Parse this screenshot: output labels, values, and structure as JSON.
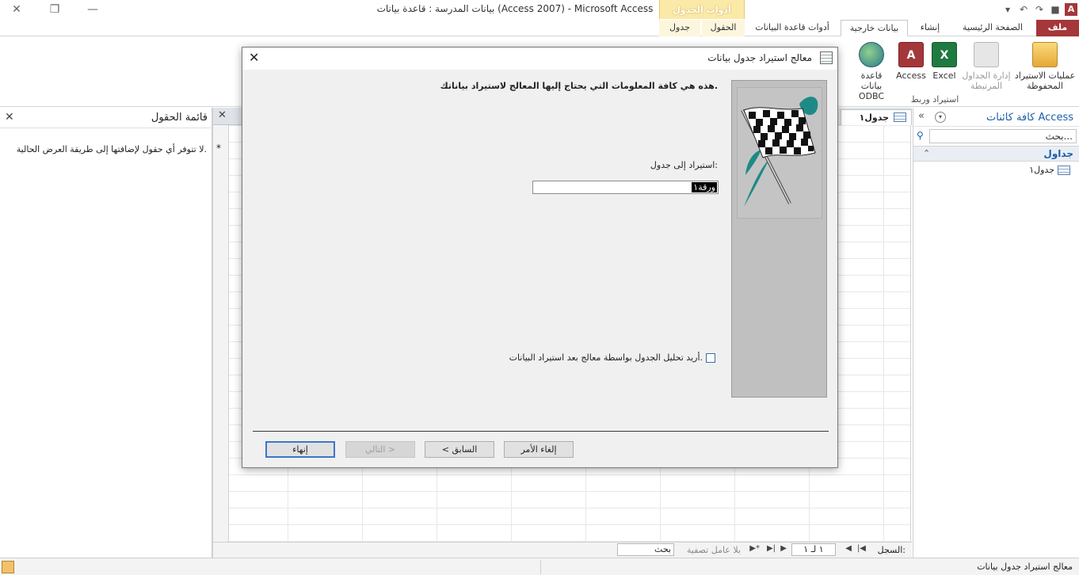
{
  "window": {
    "title": "بيانات المدرسة : قاعدة بيانات (Access 2007) - Microsoft Access",
    "context_tab_title": "أدوات الجدول"
  },
  "ribbon_tabs": [
    {
      "label": "ملف"
    },
    {
      "label": "الصفحة الرئيسية"
    },
    {
      "label": "إنشاء"
    },
    {
      "label": "بيانات خارجية"
    },
    {
      "label": "أدوات قاعدة البيانات"
    },
    {
      "label": "الحقول"
    },
    {
      "label": "جدول"
    }
  ],
  "ribbon": {
    "buttons": [
      {
        "label": "عمليات الاستيراد المحفوظة"
      },
      {
        "label": "إدارة الجداول المرتبطة"
      },
      {
        "label": "Excel"
      },
      {
        "label": "Access"
      },
      {
        "label": "قاعدة بيانات ODBC"
      }
    ],
    "group_label": "استيراد وربط"
  },
  "nav_pane": {
    "title": "كافة كائنات Access",
    "search_placeholder": "بحث...",
    "group": "جداول",
    "items": [
      {
        "label": "جدول١"
      }
    ]
  },
  "document": {
    "tab_label": "جدول١",
    "new_row_marker": "*",
    "record_nav": {
      "label": "السجل:",
      "position": "١ لـ ١",
      "filter": "بلا عامل تصفية",
      "search": "بحث"
    }
  },
  "field_list": {
    "title": "قائمة الحقول",
    "message": "لا تتوفر أي حقول لإضافتها إلى طريقة العرض الحالية."
  },
  "dialog": {
    "title": "معالج استيراد جدول بيانات",
    "intro": "هذه هي كافة المعلومات التي يحتاج إليها المعالج لاستيراد بياناتك.",
    "import_label": "استيراد إلى جدول:",
    "table_name_value": "ورقة١",
    "checkbox_label": "أريد تحليل الجدول بواسطة معالج بعد استيراد البيانات.",
    "checkbox_checked": false,
    "buttons": {
      "cancel": "إلغاء الأمر",
      "back": "< السابق",
      "next": "التالي >",
      "finish": "إنهاء"
    }
  },
  "status_bar": {
    "text": "معالج استيراد جدول بيانات"
  }
}
